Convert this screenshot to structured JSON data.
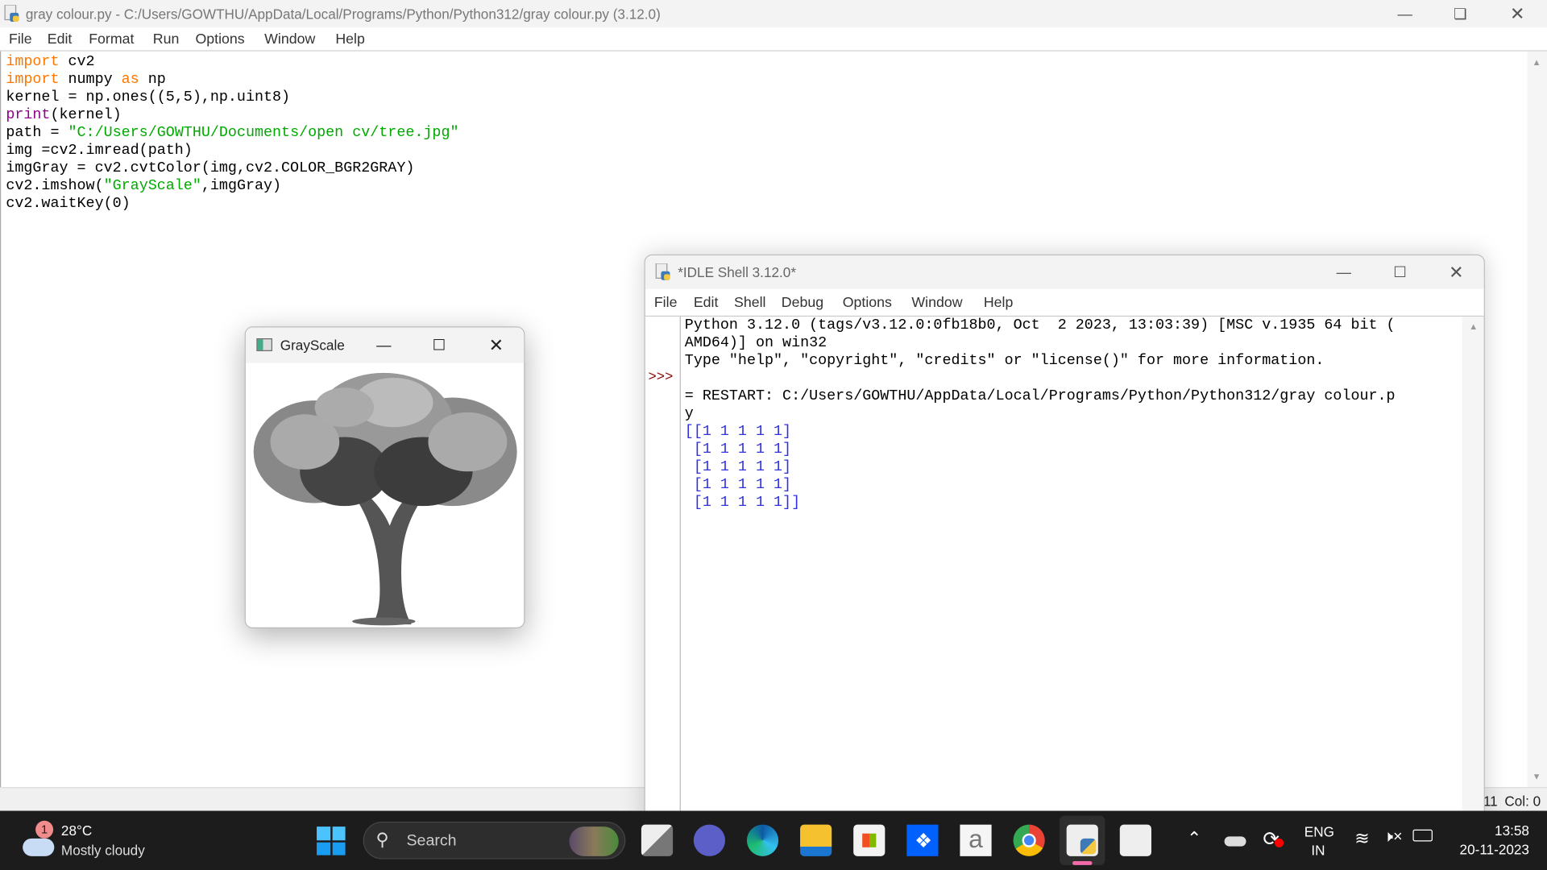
{
  "editor": {
    "title": "gray colour.py - C:/Users/GOWTHU/AppData/Local/Programs/Python/Python312/gray colour.py (3.12.0)",
    "menu": [
      "File",
      "Edit",
      "Format",
      "Run",
      "Options",
      "Window",
      "Help"
    ],
    "code": [
      {
        "kw": "import",
        "rest": " cv2"
      },
      {
        "kw": "import",
        "mid": " numpy ",
        "kw2": "as",
        "rest": " np"
      },
      {
        "plain": "kernel = np.ones((5,5),np.uint8)"
      },
      {
        "bi": "print",
        "rest": "(kernel)"
      },
      {
        "pre": "path = ",
        "str": "\"C:/Users/GOWTHU/Documents/open cv/tree.jpg\""
      },
      {
        "plain": "img =cv2.imread(path)"
      },
      {
        "plain": "imgGray = cv2.cvtColor(img,cv2.COLOR_BGR2GRAY)"
      },
      {
        "pre": "cv2.imshow(",
        "str": "\"GrayScale\"",
        "rest": ",imgGray)"
      },
      {
        "plain": "cv2.waitKey(0)"
      }
    ],
    "status": {
      "ln": "Ln: 11",
      "col": "Col: 0"
    }
  },
  "shell": {
    "title": "*IDLE Shell 3.12.0*",
    "menu": [
      "File",
      "Edit",
      "Shell",
      "Debug",
      "Options",
      "Window",
      "Help"
    ],
    "prompt": ">>>",
    "lines": [
      "Python 3.12.0 (tags/v3.12.0:0fb18b0, Oct  2 2023, 13:03:39) [MSC v.1935 64 bit (",
      "AMD64)] on win32",
      "Type \"help\", \"copyright\", \"credits\" or \"license()\" for more information.",
      "",
      "= RESTART: C:/Users/GOWTHU/AppData/Local/Programs/Python/Python312/gray colour.p",
      "y"
    ],
    "output": [
      "[[1 1 1 1 1]",
      " [1 1 1 1 1]",
      " [1 1 1 1 1]",
      " [1 1 1 1 1]",
      " [1 1 1 1 1]]"
    ]
  },
  "grayscale": {
    "title": "GrayScale"
  },
  "taskbar": {
    "weather": {
      "temp": "28°C",
      "desc": "Mostly cloudy",
      "badge": "1"
    },
    "search_placeholder": "Search",
    "lang": {
      "line1": "ENG",
      "line2": "IN"
    },
    "time": "13:58",
    "date": "20-11-2023",
    "apps": [
      "task-view",
      "teams-chat",
      "edge",
      "file-explorer",
      "microsoft-store",
      "dropbox",
      "amazon",
      "chrome",
      "idle-python",
      "snipping-tool"
    ]
  }
}
